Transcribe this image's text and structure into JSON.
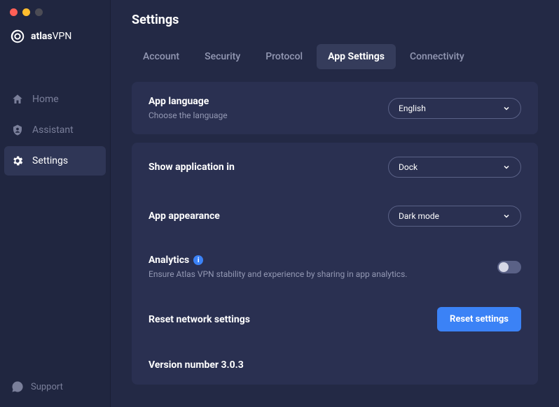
{
  "app": {
    "name_bold": "atlas",
    "name_light": "VPN"
  },
  "nav": {
    "home": "Home",
    "assistant": "Assistant",
    "settings": "Settings",
    "support": "Support"
  },
  "page": {
    "title": "Settings"
  },
  "tabs": {
    "account": "Account",
    "security": "Security",
    "protocol": "Protocol",
    "app_settings": "App Settings",
    "connectivity": "Connectivity"
  },
  "settings": {
    "language": {
      "title": "App language",
      "sub": "Choose the language",
      "value": "English"
    },
    "show_in": {
      "title": "Show application in",
      "value": "Dock"
    },
    "appearance": {
      "title": "App appearance",
      "value": "Dark mode"
    },
    "analytics": {
      "title": "Analytics",
      "sub": "Ensure Atlas VPN stability and experience by sharing in app analytics."
    },
    "reset": {
      "title": "Reset network settings",
      "button": "Reset settings"
    },
    "version": {
      "title": "Version number 3.0.3"
    }
  }
}
